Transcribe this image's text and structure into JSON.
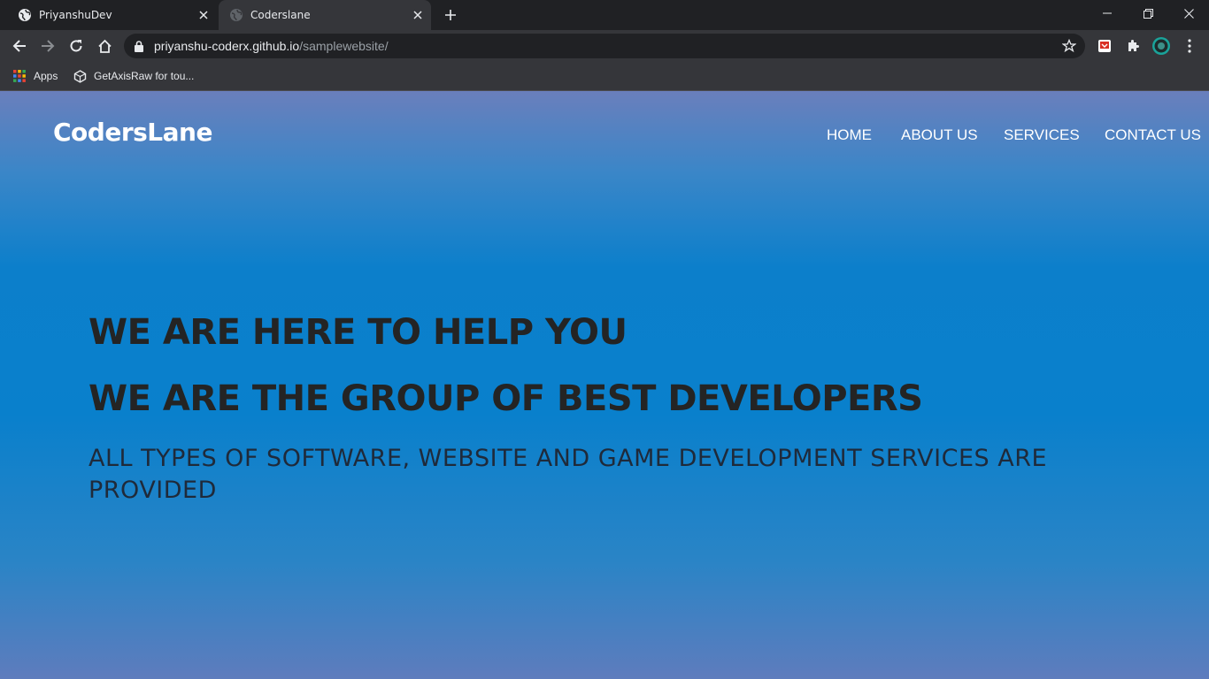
{
  "browser": {
    "tabs": [
      {
        "title": "PriyanshuDev",
        "icon": "globe-icon",
        "active": false
      },
      {
        "title": "Coderslane",
        "icon": "globe-icon",
        "active": true
      }
    ],
    "address_bar": {
      "url_host": "priyanshu-coderx.github.io",
      "url_path": "/samplewebsite/"
    },
    "bookmarks": [
      {
        "label": "Apps",
        "icon": "apps-grid-icon"
      },
      {
        "label": "GetAxisRaw for tou...",
        "icon": "unity-icon"
      }
    ],
    "extension_colors": {
      "red_badge": "#d93025",
      "avatar_ring": "#1aa39a"
    }
  },
  "site": {
    "logo": "CodersLane",
    "nav": [
      "HOME",
      "ABOUT US",
      "SERVICES",
      "CONTACT US"
    ],
    "hero": {
      "heading_1": "WE ARE HERE TO HELP YOU",
      "heading_2": "WE ARE THE GROUP OF BEST DEVELOPERS",
      "subtext": "ALL TYPES OF SOFTWARE, WEBSITE AND GAME DEVELOPMENT SERVICES ARE PROVIDED"
    },
    "colors": {
      "accent": "#0980cc",
      "heading": "#242424",
      "nav_text": "#ffffff"
    }
  }
}
